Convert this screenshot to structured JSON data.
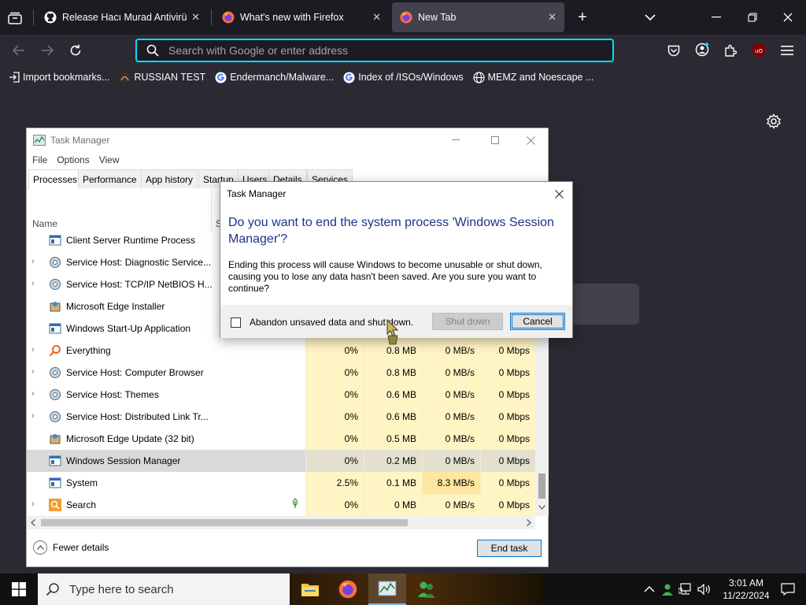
{
  "browser": {
    "tabs": [
      {
        "label": "Release Hacı Murad Antivirüs B",
        "close": "✕"
      },
      {
        "label": "What's new with Firefox",
        "close": "✕"
      },
      {
        "label": "New Tab",
        "close": "✕"
      }
    ],
    "new_tab": "+",
    "urlbar_placeholder": "Search with Google or enter address",
    "bookmarks": [
      {
        "label": "Import bookmarks...",
        "icon": "import-icon"
      },
      {
        "label": "RUSSIAN TEST",
        "icon": "site-icon"
      },
      {
        "label": "Endermanch/Malware...",
        "icon": "google-icon"
      },
      {
        "label": "Index of /ISOs/Windows",
        "icon": "google-icon"
      },
      {
        "label": "MEMZ and Noescape ...",
        "icon": "globe-icon"
      }
    ]
  },
  "task_manager": {
    "title": "Task Manager",
    "menu": [
      "File",
      "Options",
      "View"
    ],
    "tabs": [
      "Processes",
      "Performance",
      "App history",
      "Startup",
      "Users",
      "Details",
      "Services"
    ],
    "column_name": "Name",
    "column_stub": "S",
    "rows": [
      {
        "arrow": "",
        "name": "Client Server Runtime Process",
        "cpu": "",
        "mem": "",
        "disk": "",
        "net": ""
      },
      {
        "arrow": "›",
        "name": "Service Host: Diagnostic Service...",
        "cpu": "",
        "mem": "",
        "disk": "",
        "net": ""
      },
      {
        "arrow": "›",
        "name": "Service Host: TCP/IP NetBIOS H...",
        "cpu": "",
        "mem": "",
        "disk": "",
        "net": ""
      },
      {
        "arrow": "",
        "name": "Microsoft Edge Installer",
        "cpu": "",
        "mem": "",
        "disk": "",
        "net": ""
      },
      {
        "arrow": "",
        "name": "Windows Start-Up Application",
        "cpu": "",
        "mem": "",
        "disk": "",
        "net": ""
      },
      {
        "arrow": "›",
        "name": "Everything",
        "cpu": "0%",
        "mem": "0.8 MB",
        "disk": "0 MB/s",
        "net": "0 Mbps"
      },
      {
        "arrow": "›",
        "name": "Service Host: Computer Browser",
        "cpu": "0%",
        "mem": "0.8 MB",
        "disk": "0 MB/s",
        "net": "0 Mbps"
      },
      {
        "arrow": "›",
        "name": "Service Host: Themes",
        "cpu": "0%",
        "mem": "0.6 MB",
        "disk": "0 MB/s",
        "net": "0 Mbps"
      },
      {
        "arrow": "›",
        "name": "Service Host: Distributed Link Tr...",
        "cpu": "0%",
        "mem": "0.6 MB",
        "disk": "0 MB/s",
        "net": "0 Mbps"
      },
      {
        "arrow": "",
        "name": "Microsoft Edge Update (32 bit)",
        "cpu": "0%",
        "mem": "0.5 MB",
        "disk": "0 MB/s",
        "net": "0 Mbps"
      },
      {
        "arrow": "",
        "name": "Windows Session Manager",
        "cpu": "0%",
        "mem": "0.2 MB",
        "disk": "0 MB/s",
        "net": "0 Mbps"
      },
      {
        "arrow": "",
        "name": "System",
        "cpu": "2.5%",
        "mem": "0.1 MB",
        "disk": "8.3 MB/s",
        "net": "0 Mbps"
      },
      {
        "arrow": "›",
        "name": "Search",
        "cpu": "0%",
        "mem": "0 MB",
        "disk": "0 MB/s",
        "net": "0 Mbps"
      }
    ],
    "fewer_details": "Fewer details",
    "end_task": "End task"
  },
  "dialog": {
    "title": "Task Manager",
    "question": "Do you want to end the system process 'Windows Session Manager'?",
    "body": "Ending this process will cause Windows to become unusable or shut down, causing you to lose any data hasn't been saved. Are you sure you want to continue?",
    "checkbox_label": "Abandon unsaved data and shut down.",
    "shutdown_label": "Shut down",
    "cancel_label": "Cancel"
  },
  "taskbar": {
    "search_placeholder": "Type here to search",
    "time": "3:01 AM",
    "date": "11/22/2024"
  },
  "colors": {
    "accent": "#00ddff",
    "dialog_heading": "#1e3287",
    "cell_highlight": "#fff4c4"
  }
}
